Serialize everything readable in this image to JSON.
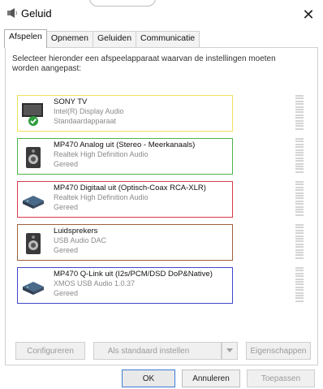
{
  "window": {
    "title": "Geluid",
    "close_glyph": "✕"
  },
  "tabs": [
    "Afspelen",
    "Opnemen",
    "Geluiden",
    "Communicatie"
  ],
  "instruction": "Selecteer hieronder een afspeelapparaat waarvan de instellingen moeten worden aangepast:",
  "devices": [
    {
      "name": "SONY TV",
      "driver": "Intel(R) Display Audio",
      "status": "Standaardapparaat",
      "icon": "monitor-icon",
      "border_color": "#f2e15a",
      "is_default": true
    },
    {
      "name": "MP470 Analog uit (Stereo - Meerkanaals)",
      "driver": "Realtek High Definition Audio",
      "status": "Gereed",
      "icon": "speaker-icon",
      "border_color": "#4db34d"
    },
    {
      "name": "MP470 Digitaal uit (Optisch-Coax RCA-XLR)",
      "driver": "Realtek High Definition Audio",
      "status": "Gereed",
      "icon": "digital-output-icon",
      "border_color": "#d9394a"
    },
    {
      "name": "Luidsprekers",
      "driver": "USB Audio DAC",
      "status": "Gereed",
      "icon": "speaker-icon",
      "border_color": "#a0603a"
    },
    {
      "name": "MP470 Q-Link uit (I2s/PCM/DSD DoP&Native)",
      "driver": "XMOS USB Audio 1.0.37",
      "status": "Gereed",
      "icon": "digital-output-icon",
      "border_color": "#3f45c9"
    }
  ],
  "buttons": {
    "configure": "Configureren",
    "set_default": "Als standaard instellen",
    "properties": "Eigenschappen",
    "ok": "OK",
    "cancel": "Annuleren",
    "apply": "Toepassen"
  }
}
